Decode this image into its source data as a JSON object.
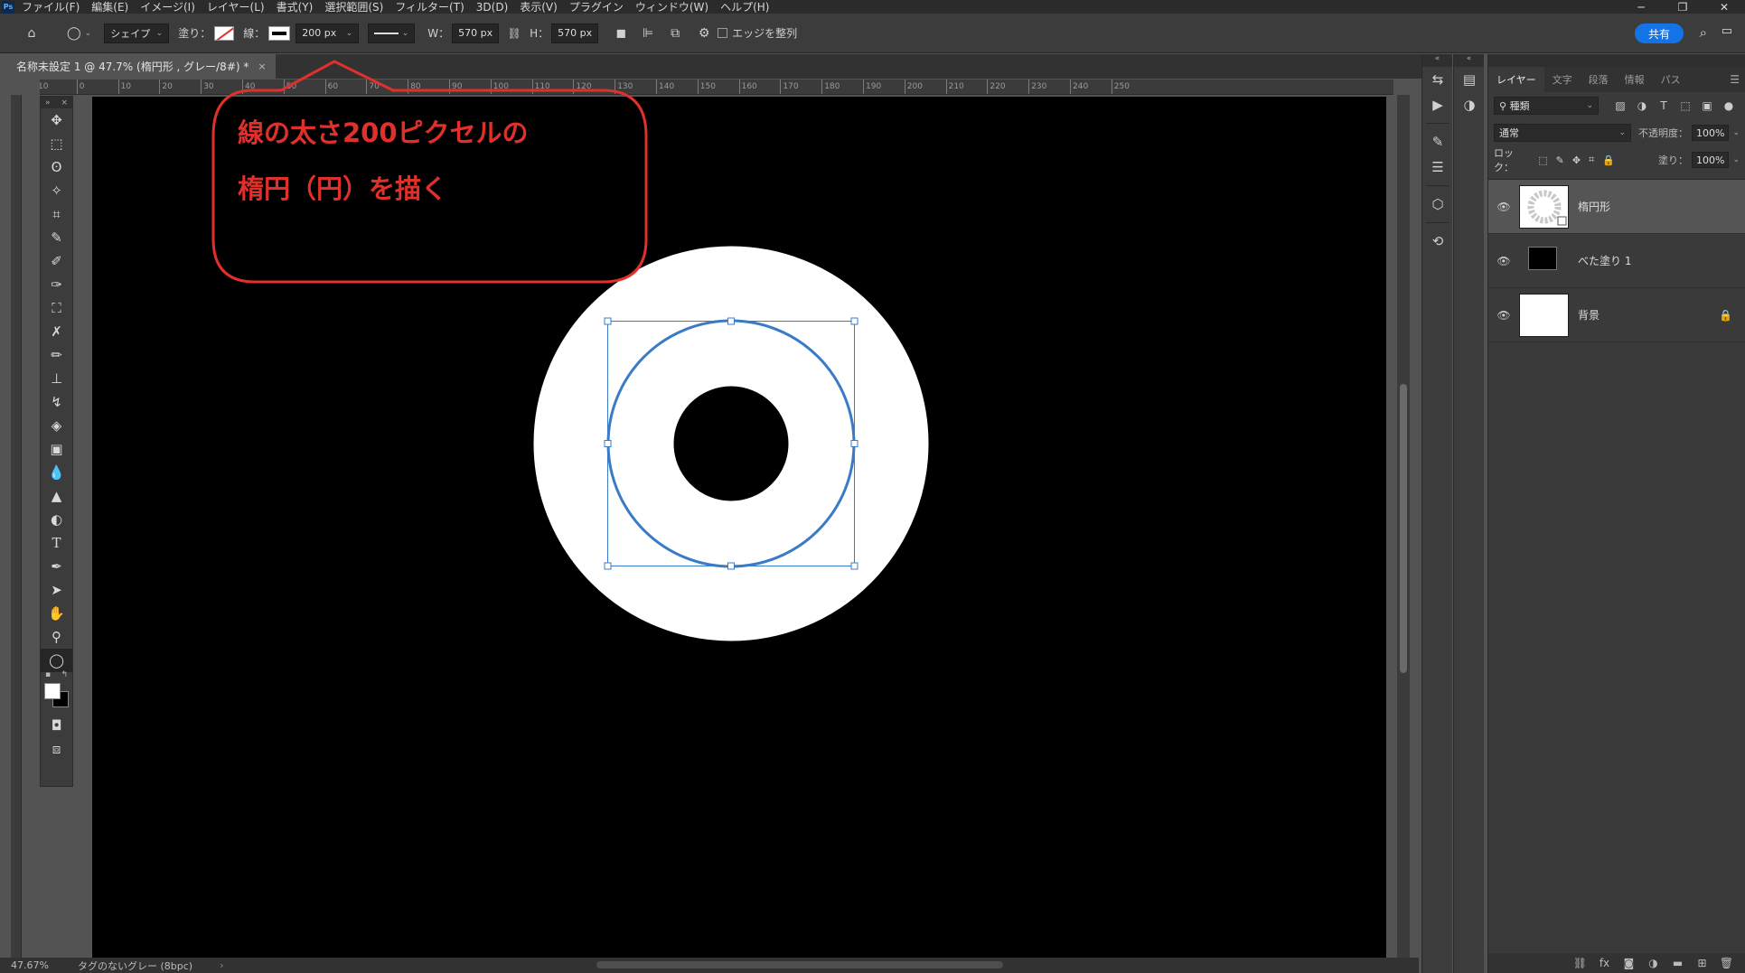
{
  "app": {
    "logo": "Ps"
  },
  "menu": [
    "ファイル(F)",
    "編集(E)",
    "イメージ(I)",
    "レイヤー(L)",
    "書式(Y)",
    "選択範囲(S)",
    "フィルター(T)",
    "3D(D)",
    "表示(V)",
    "プラグイン",
    "ウィンドウ(W)",
    "ヘルプ(H)"
  ],
  "window_controls": {
    "minimize": "─",
    "restore": "❐",
    "close": "✕"
  },
  "options": {
    "home_icon": "home-icon",
    "shape_mode": "シェイプ",
    "fill_label": "塗り：",
    "stroke_label": "線：",
    "stroke_width": "200 px",
    "w_label": "W：",
    "w_value": "570 px",
    "h_label": "H：",
    "h_value": "570 px",
    "align_edges_label": "エッジを整列",
    "share_label": "共有"
  },
  "document": {
    "tab_title": "名称未設定 1 @ 47.7% (楕円形 , グレー/8#) *",
    "close": "×"
  },
  "ruler": {
    "labels": [
      "10",
      "0",
      "10",
      "20",
      "30",
      "40",
      "50",
      "60",
      "70",
      "80",
      "90",
      "100",
      "110",
      "120",
      "130",
      "140",
      "150",
      "160",
      "170",
      "180",
      "190",
      "200",
      "210",
      "220",
      "230",
      "240",
      "250"
    ]
  },
  "annotation": {
    "line1": "線の太さ200ピクセルの",
    "line2": "楕円（円）を描く",
    "color": "#e0302b"
  },
  "status": {
    "zoom": "47.67%",
    "profile": "タグのないグレー (8bpc)",
    "arrow": "›"
  },
  "layers_panel": {
    "tabs": [
      "レイヤー",
      "文字",
      "段落",
      "情報",
      "パス"
    ],
    "filter_kind": "種類",
    "blend_mode": "通常",
    "opacity_label": "不透明度：",
    "opacity_value": "100%",
    "lock_label": "ロック：",
    "fill_label": "塗り：",
    "fill_value": "100%",
    "layers": [
      {
        "name": "楕円形",
        "selected": true
      },
      {
        "name": "べた塗り 1",
        "selected": false
      },
      {
        "name": "背景",
        "selected": false,
        "locked": true
      }
    ]
  },
  "colors": {
    "accent": "#1473e6",
    "path": "#3a7bc8",
    "canvas": "#000000",
    "ring": "#ffffff"
  }
}
